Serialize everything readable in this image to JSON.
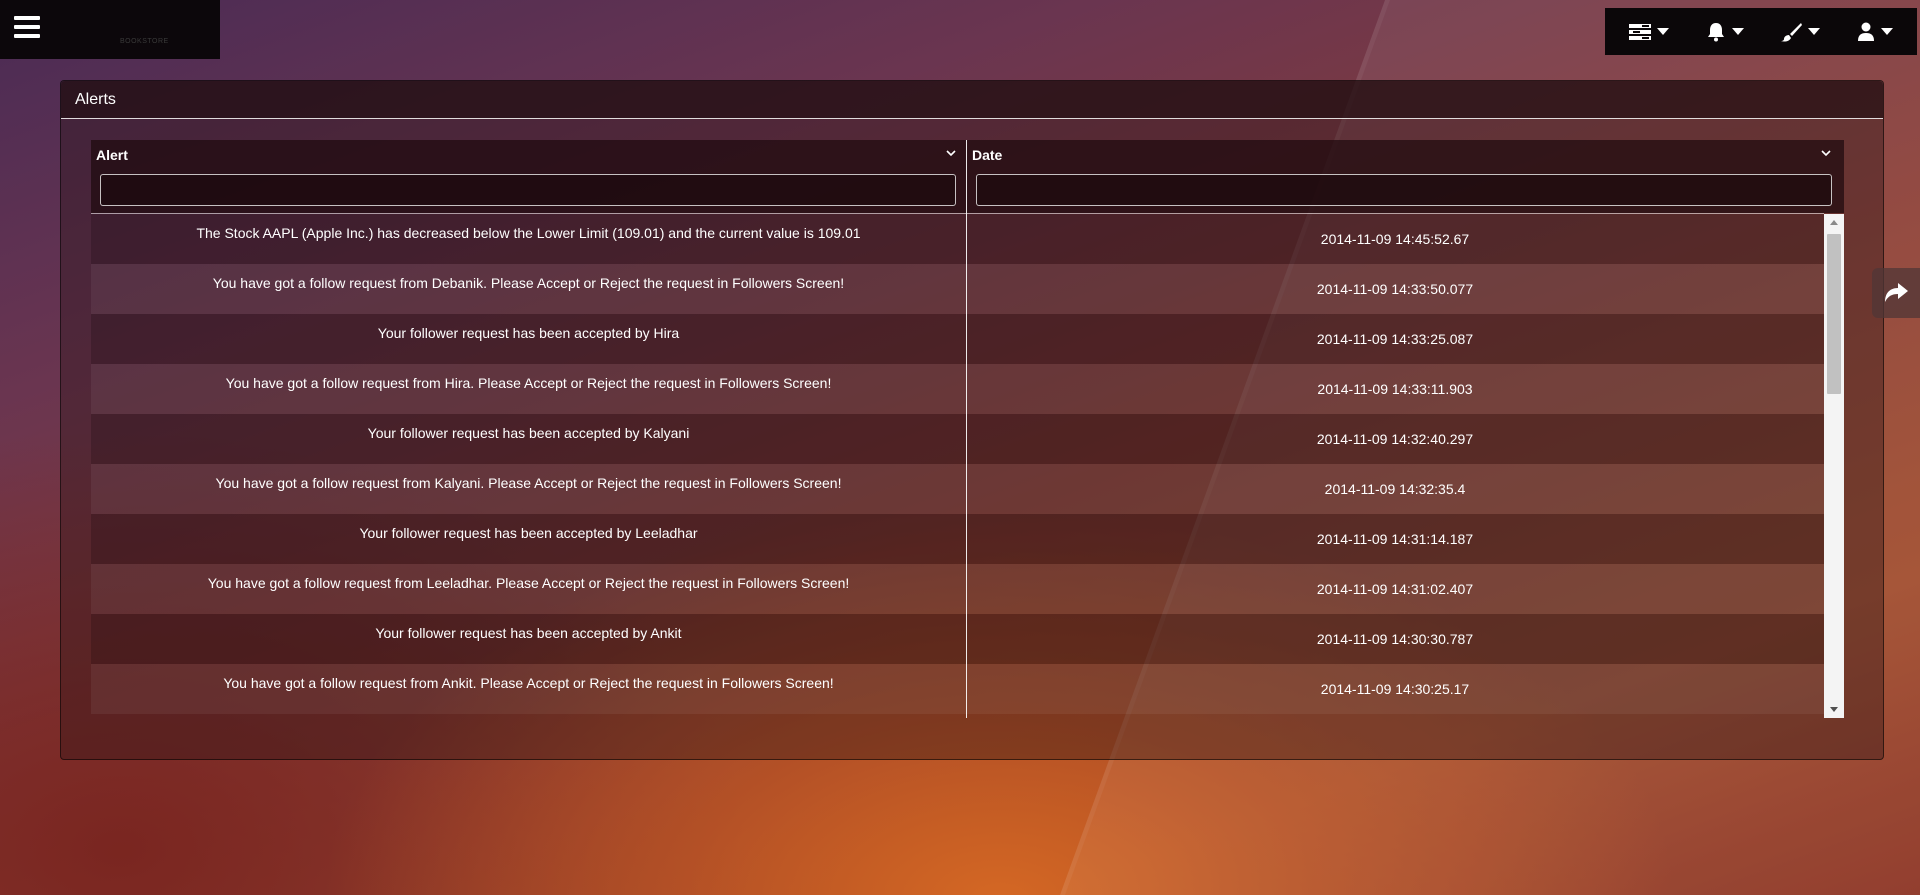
{
  "header": {
    "logo_text": "BOOKSTORE",
    "menu_icon": "hamburger-menu-icon"
  },
  "toolbar": {
    "items": [
      {
        "icon": "list-view-icon",
        "label": "Views"
      },
      {
        "icon": "bell-icon",
        "label": "Notifications"
      },
      {
        "icon": "paintbrush-icon",
        "label": "Themes"
      },
      {
        "icon": "user-icon",
        "label": "Account"
      }
    ]
  },
  "panel": {
    "title": "Alerts"
  },
  "grid": {
    "columns": [
      {
        "key": "alert",
        "label": "Alert",
        "filter_value": ""
      },
      {
        "key": "date",
        "label": "Date",
        "filter_value": ""
      }
    ],
    "rows": [
      {
        "alert": "The Stock AAPL (Apple Inc.) has decreased below the Lower Limit (109.01) and the current value is 109.01",
        "date": "2014-11-09 14:45:52.67"
      },
      {
        "alert": "You have got a follow request from Debanik. Please Accept or Reject the request in Followers Screen!",
        "date": "2014-11-09 14:33:50.077"
      },
      {
        "alert": "Your follower request has been accepted by Hira",
        "date": "2014-11-09 14:33:25.087"
      },
      {
        "alert": "You have got a follow request from Hira. Please Accept or Reject the request in Followers Screen!",
        "date": "2014-11-09 14:33:11.903"
      },
      {
        "alert": "Your follower request has been accepted by Kalyani",
        "date": "2014-11-09 14:32:40.297"
      },
      {
        "alert": "You have got a follow request from Kalyani. Please Accept or Reject the request in Followers Screen!",
        "date": "2014-11-09 14:32:35.4"
      },
      {
        "alert": "Your follower request has been accepted by Leeladhar",
        "date": "2014-11-09 14:31:14.187"
      },
      {
        "alert": "You have got a follow request from Leeladhar. Please Accept or Reject the request in Followers Screen!",
        "date": "2014-11-09 14:31:02.407"
      },
      {
        "alert": "Your follower request has been accepted by Ankit",
        "date": "2014-11-09 14:30:30.787"
      },
      {
        "alert": "You have got a follow request from Ankit. Please Accept or Reject the request in Followers Screen!",
        "date": "2014-11-09 14:30:25.17"
      }
    ]
  },
  "side": {
    "share_icon": "share-arrow-icon"
  },
  "colors": {
    "toolbar_bg": "#0b0709",
    "text": "#ffffff",
    "scroll_track": "#f4f4f4",
    "scroll_thumb": "#c1c1c1"
  }
}
